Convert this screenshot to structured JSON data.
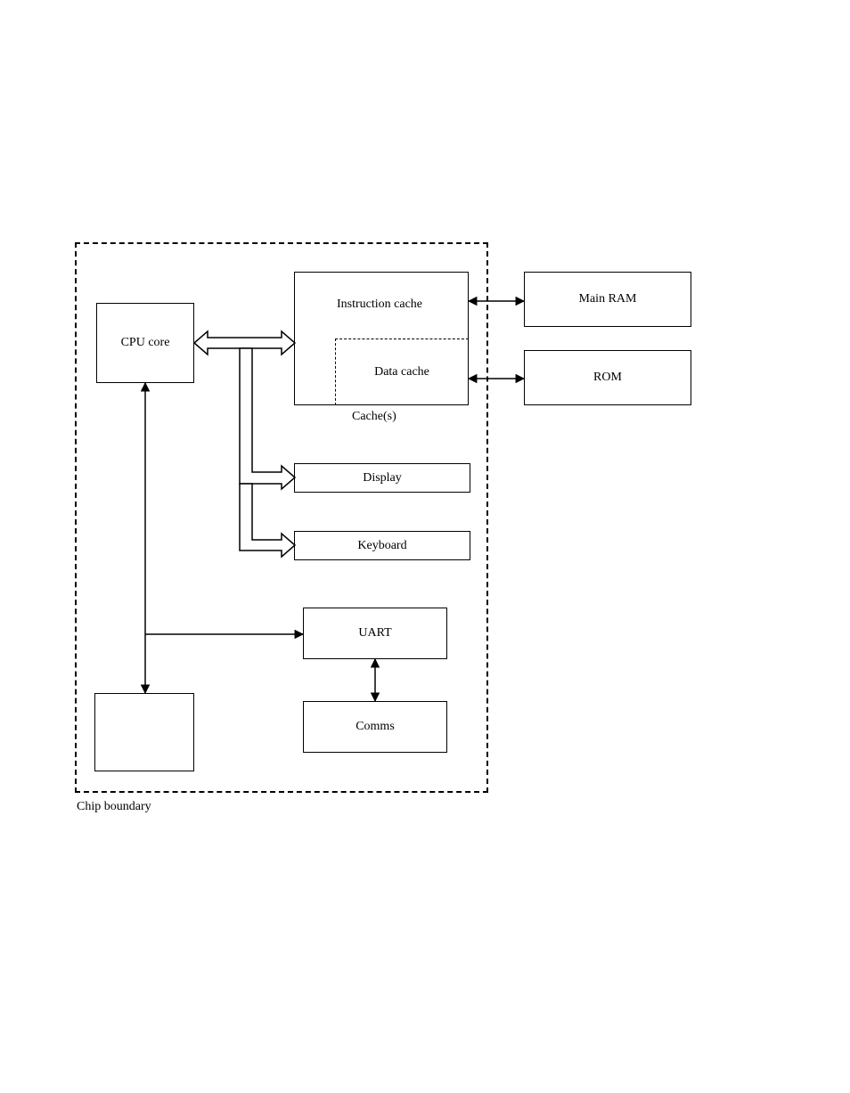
{
  "diagram": {
    "boundary_label": "Chip boundary",
    "cpu": {
      "label": "CPU core"
    },
    "cache": {
      "label_top": "Instruction cache",
      "label_bottom": "Data cache",
      "combined_label": "Cache(s)"
    },
    "ram": {
      "label": "Main RAM"
    },
    "rom": {
      "label": "ROM"
    },
    "display": {
      "label": "Display"
    },
    "keyboard": {
      "label": "Keyboard"
    },
    "uart": {
      "label": "UART"
    },
    "comms": {
      "label": "Comms"
    }
  }
}
